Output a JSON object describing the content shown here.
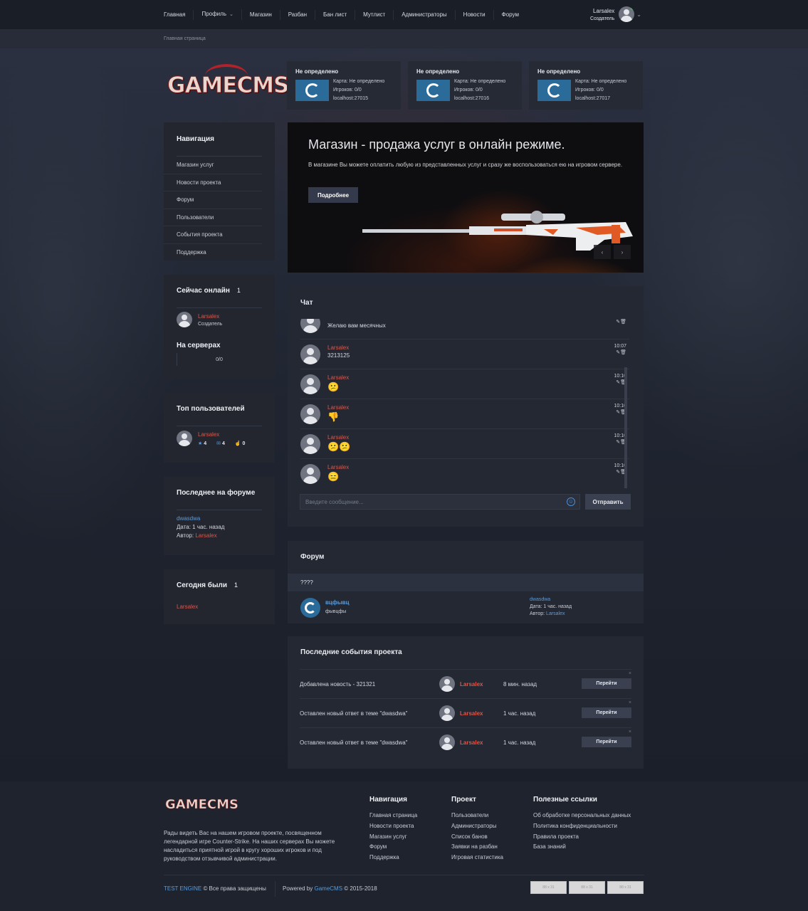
{
  "nav": {
    "links": [
      "Главная",
      "Профиль",
      "Магазин",
      "Разбан",
      "Бан лист",
      "Мутлист",
      "Администраторы",
      "Новости",
      "Форум"
    ],
    "user_name": "Larsalex",
    "user_role": "Создатель"
  },
  "breadcrumb": "Главная страница",
  "servers": [
    {
      "title": "Не определено",
      "map": "Карта: Не определено",
      "players": "Игроков: 0/0",
      "address": "localhost:27015"
    },
    {
      "title": "Не определено",
      "map": "Карта: Не определено",
      "players": "Игроков: 0/0",
      "address": "localhost:27016"
    },
    {
      "title": "Не определено",
      "map": "Карта: Не определено",
      "players": "Игроков: 0/0",
      "address": "localhost:27017"
    }
  ],
  "logo": "GAMECMS",
  "sidebar": {
    "nav_title": "Навигация",
    "nav_items": [
      "Магазин услуг",
      "Новости проекта",
      "Форум",
      "Пользователи",
      "События проекта",
      "Поддержка"
    ],
    "online_title": "Сейчас онлайн",
    "online_count": "1",
    "online_user": "Larsalex",
    "online_role": "Создатель",
    "servers_title": "На серверах",
    "servers_value": "0/0",
    "top_title": "Топ пользователей",
    "top_user": "Larsalex",
    "top_stats": [
      "4",
      "4",
      "0"
    ],
    "forum_title": "Последнее на форуме",
    "forum_topic": "dwasdwa",
    "forum_date": "Дата: 1 час. назад",
    "forum_author_label": "Автор:",
    "forum_author": "Larsalex",
    "today_title": "Сегодня были",
    "today_count": "1",
    "today_user": "Larsalex"
  },
  "slider": {
    "title": "Магазин - продажа услуг в онлайн режиме.",
    "text": "В магазине Вы можете оплатить любую из представленных услуг и сразу же воспользоваться ею на игровом сервере.",
    "button": "Подробнее",
    "prev": "‹",
    "next": "›"
  },
  "chat": {
    "title": "Чат",
    "messages": [
      {
        "name": "",
        "text": "Желаю вам месячных",
        "time": ""
      },
      {
        "name": "Larsalex",
        "text": "3213125",
        "time": "10:07"
      },
      {
        "name": "Larsalex",
        "text": "😕",
        "time": "10:10"
      },
      {
        "name": "Larsalex",
        "text": "👎",
        "time": "10:10"
      },
      {
        "name": "Larsalex",
        "text": "😕😕",
        "time": "10:10"
      },
      {
        "name": "Larsalex",
        "text": "😑",
        "time": "10:10"
      }
    ],
    "placeholder": "Введите сообщение...",
    "send": "Отправить"
  },
  "forum": {
    "title": "Форум",
    "category": "????",
    "section_name": "вцфывц",
    "section_desc": "фывцфы",
    "last_topic": "dwasdwa",
    "last_date": "Дата: 1 час. назад",
    "last_author_label": "Автор:",
    "last_author": "Larsalex"
  },
  "events": {
    "title": "Последние события проекта",
    "rows": [
      {
        "text": "Добавлена новость - 321321",
        "user": "Larsalex",
        "time": "8 мин. назад",
        "button": "Перейти"
      },
      {
        "text": "Оставлен новый ответ в теме \"dwasdwa\"",
        "user": "Larsalex",
        "time": "1 час. назад",
        "button": "Перейти"
      },
      {
        "text": "Оставлен новый ответ в теме \"dwasdwa\"",
        "user": "Larsalex",
        "time": "1 час. назад",
        "button": "Перейти"
      }
    ]
  },
  "footer": {
    "logo": "GAMECMS",
    "about": "Рады видеть Вас на нашем игровом проекте, посвященном легендарной игре Counter-Strike. На наших серверах Вы можете насладиться приятной игрой в кругу хороших игроков и под руководством отзывчивой администрации.",
    "nav_title": "Навигация",
    "nav_links": [
      "Главная страница",
      "Новости проекта",
      "Магазин услуг",
      "Форум",
      "Поддержка"
    ],
    "project_title": "Проект",
    "project_links": [
      "Пользователи",
      "Администраторы",
      "Список банов",
      "Заявки на разбан",
      "Игровая статистика"
    ],
    "useful_title": "Полезные ссылки",
    "useful_links": [
      "Об обработке персональных данных",
      "Политика конфиденциальности",
      "Правила проекта",
      "База знаний"
    ],
    "engine": "TEST ENGINE",
    "rights": "© Все права защищены",
    "powered": "Powered by",
    "powered_link": "GameCMS",
    "years": "© 2015-2018",
    "counter_label": "88 x 31"
  },
  "colors": {
    "accent_red": "#d9574b",
    "link_blue": "#5b9bd9",
    "bg": "#1d212c",
    "panel": "#242833"
  }
}
